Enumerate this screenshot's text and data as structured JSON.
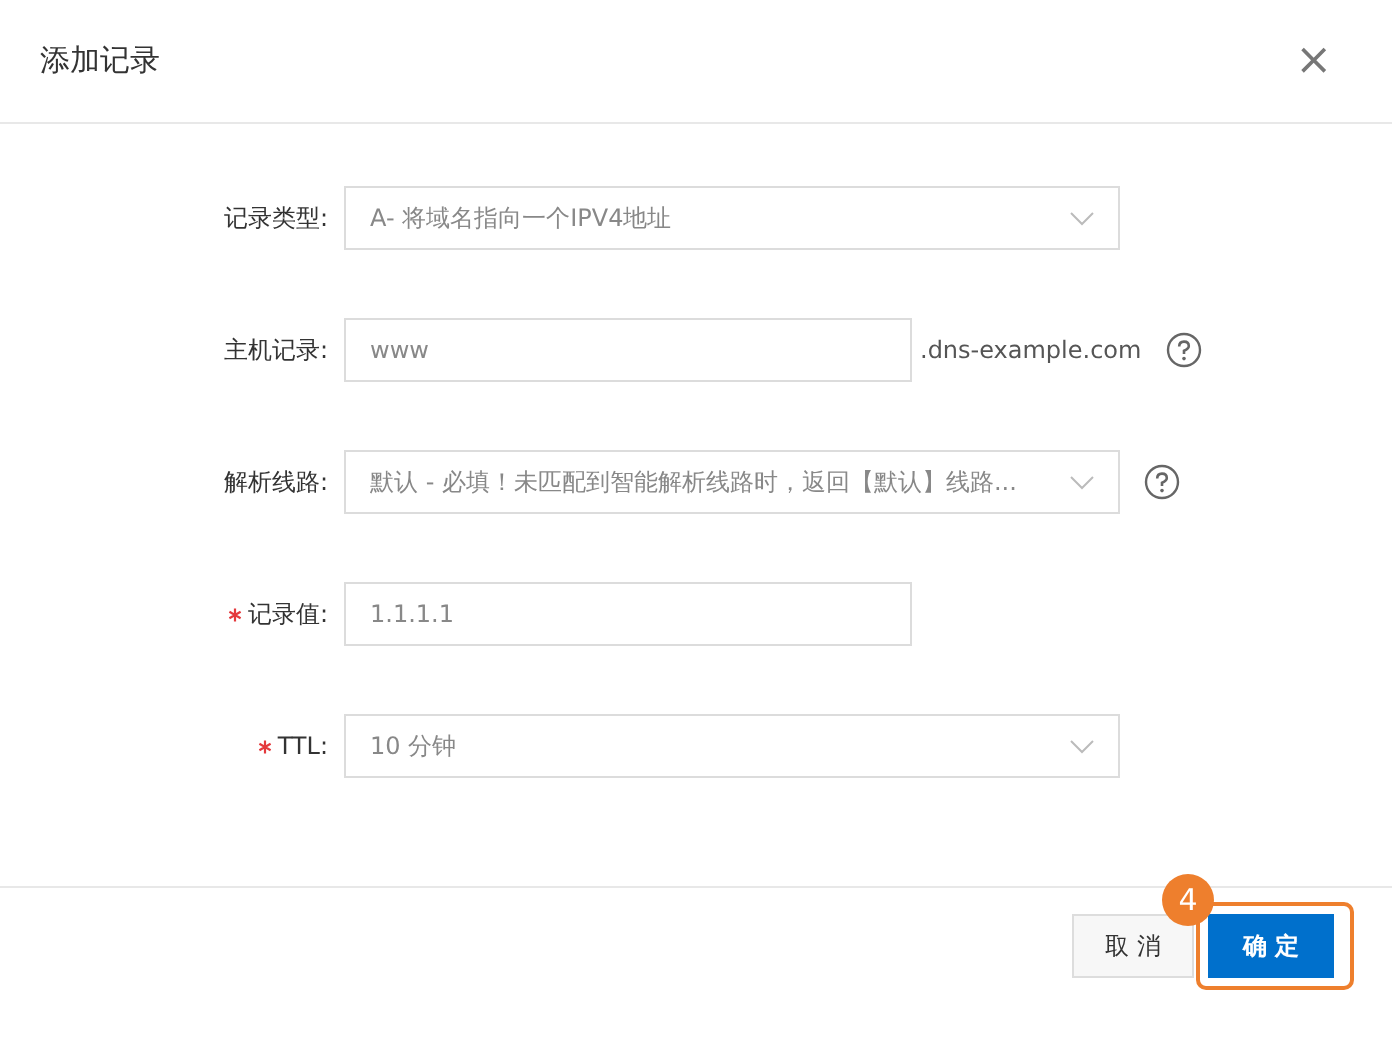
{
  "dialog": {
    "title": "添加记录",
    "close": "×"
  },
  "fields": [
    {
      "kind": "select",
      "label": "记录类型:",
      "required": false,
      "value": "A- 将域名指向一个IPV4地址",
      "help": false
    },
    {
      "kind": "input",
      "label": "主机记录:",
      "required": false,
      "value": "www",
      "suffix": ".dns-example.com",
      "help": true
    },
    {
      "kind": "select",
      "label": "解析线路:",
      "required": false,
      "value": "默认 - 必填！未匹配到智能解析线路时，返回【默认】线路...",
      "help": true
    },
    {
      "kind": "input",
      "label": "记录值:",
      "required": true,
      "value": "1.1.1.1",
      "help": false
    },
    {
      "kind": "select",
      "label": "TTL:",
      "required": true,
      "value": "10 分钟",
      "help": false
    }
  ],
  "buttons": [
    {
      "label": "取 消",
      "kind": "secondary"
    },
    {
      "label": "确 定",
      "kind": "primary",
      "highlighted": true
    }
  ],
  "callout": {
    "number": "4"
  }
}
